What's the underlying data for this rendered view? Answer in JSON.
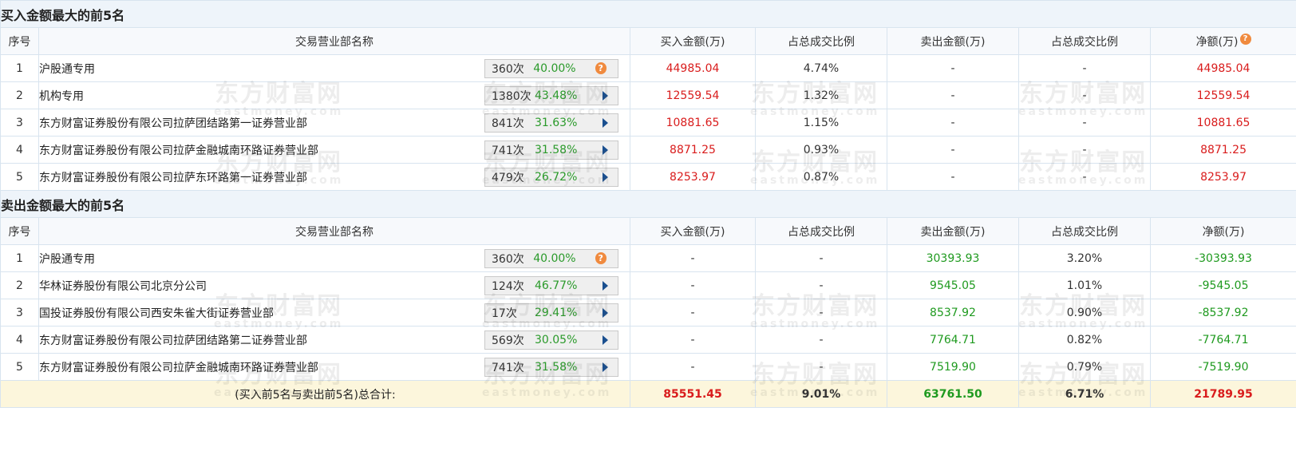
{
  "buy_section": {
    "title": "买入金额最大的前5名",
    "headers": [
      "序号",
      "交易营业部名称",
      "买入金额(万)",
      "占总成交比例",
      "卖出金额(万)",
      "占总成交比例",
      "净额(万)"
    ],
    "rows": [
      {
        "idx": "1",
        "name": "沪股通专用",
        "count": "360次",
        "rate": "40.00%",
        "icon": "help-icon",
        "buy": "44985.04",
        "buy_pct": "4.74%",
        "sell": "-",
        "sell_pct": "-",
        "net": "44985.04"
      },
      {
        "idx": "2",
        "name": "机构专用",
        "count": "1380次",
        "rate": "43.48%",
        "icon": "arrow-right-icon",
        "buy": "12559.54",
        "buy_pct": "1.32%",
        "sell": "-",
        "sell_pct": "-",
        "net": "12559.54"
      },
      {
        "idx": "3",
        "name": "东方财富证券股份有限公司拉萨团结路第一证券营业部",
        "count": "841次",
        "rate": "31.63%",
        "icon": "arrow-right-icon",
        "buy": "10881.65",
        "buy_pct": "1.15%",
        "sell": "-",
        "sell_pct": "-",
        "net": "10881.65"
      },
      {
        "idx": "4",
        "name": "东方财富证券股份有限公司拉萨金融城南环路证券营业部",
        "count": "741次",
        "rate": "31.58%",
        "icon": "arrow-right-icon",
        "buy": "8871.25",
        "buy_pct": "0.93%",
        "sell": "-",
        "sell_pct": "-",
        "net": "8871.25"
      },
      {
        "idx": "5",
        "name": "东方财富证券股份有限公司拉萨东环路第一证券营业部",
        "count": "479次",
        "rate": "26.72%",
        "icon": "arrow-right-icon",
        "buy": "8253.97",
        "buy_pct": "0.87%",
        "sell": "-",
        "sell_pct": "-",
        "net": "8253.97"
      }
    ]
  },
  "sell_section": {
    "title": "卖出金额最大的前5名",
    "headers": [
      "序号",
      "交易营业部名称",
      "买入金额(万)",
      "占总成交比例",
      "卖出金额(万)",
      "占总成交比例",
      "净额(万)"
    ],
    "rows": [
      {
        "idx": "1",
        "name": "沪股通专用",
        "count": "360次",
        "rate": "40.00%",
        "icon": "help-icon",
        "buy": "-",
        "buy_pct": "-",
        "sell": "30393.93",
        "sell_pct": "3.20%",
        "net": "-30393.93"
      },
      {
        "idx": "2",
        "name": "华林证券股份有限公司北京分公司",
        "count": "124次",
        "rate": "46.77%",
        "icon": "arrow-right-icon",
        "buy": "-",
        "buy_pct": "-",
        "sell": "9545.05",
        "sell_pct": "1.01%",
        "net": "-9545.05"
      },
      {
        "idx": "3",
        "name": "国投证券股份有限公司西安朱雀大街证券营业部",
        "count": "17次",
        "rate": "29.41%",
        "icon": "arrow-right-icon",
        "buy": "-",
        "buy_pct": "-",
        "sell": "8537.92",
        "sell_pct": "0.90%",
        "net": "-8537.92"
      },
      {
        "idx": "4",
        "name": "东方财富证券股份有限公司拉萨团结路第二证券营业部",
        "count": "569次",
        "rate": "30.05%",
        "icon": "arrow-right-icon",
        "buy": "-",
        "buy_pct": "-",
        "sell": "7764.71",
        "sell_pct": "0.82%",
        "net": "-7764.71"
      },
      {
        "idx": "5",
        "name": "东方财富证券股份有限公司拉萨金融城南环路证券营业部",
        "count": "741次",
        "rate": "31.58%",
        "icon": "arrow-right-icon",
        "buy": "-",
        "buy_pct": "-",
        "sell": "7519.90",
        "sell_pct": "0.79%",
        "net": "-7519.90"
      }
    ]
  },
  "total": {
    "label": "(买入前5名与卖出前5名)总合计:",
    "buy": "85551.45",
    "buy_pct": "9.01%",
    "sell": "63761.50",
    "sell_pct": "6.71%",
    "net": "21789.95"
  },
  "watermark": {
    "big": "东方财富网",
    "small": "eastmoney.com"
  },
  "help_glyph": "?",
  "colors": {
    "positive": "#d91c1c",
    "negative": "#1f9a1f",
    "header_bg": "#eef4fa",
    "total_bg": "#fcf6dc",
    "help": "#f08a3e"
  }
}
